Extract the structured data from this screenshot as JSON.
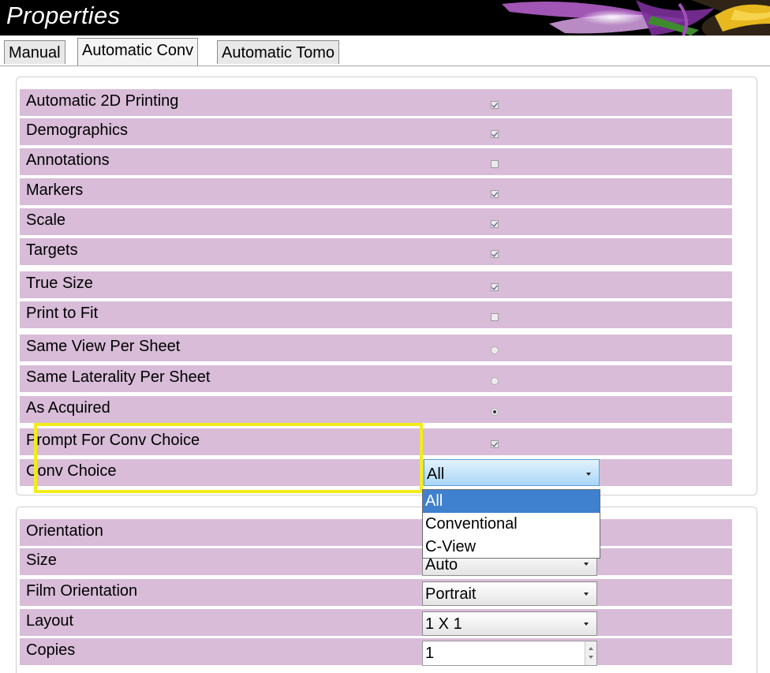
{
  "window": {
    "title": "Properties"
  },
  "tabs": [
    {
      "label": "Manual"
    },
    {
      "label": "Automatic Conv"
    },
    {
      "label": "Automatic Tomo"
    }
  ],
  "print_options": [
    {
      "label": "Automatic 2D Printing",
      "control": "checkbox",
      "checked": true
    },
    {
      "label": "Demographics",
      "control": "checkbox",
      "checked": true
    },
    {
      "label": "Annotations",
      "control": "checkbox",
      "checked": false
    },
    {
      "label": "Markers",
      "control": "checkbox",
      "checked": true
    },
    {
      "label": "Scale",
      "control": "checkbox",
      "checked": true
    },
    {
      "label": "Targets",
      "control": "checkbox",
      "checked": true
    },
    {
      "label": "True Size",
      "control": "checkbox",
      "checked": true
    },
    {
      "label": "Print to Fit",
      "control": "checkbox",
      "checked": false
    },
    {
      "label": "Same View Per Sheet",
      "control": "radio",
      "checked": false
    },
    {
      "label": "Same Laterality Per Sheet",
      "control": "radio",
      "checked": false
    },
    {
      "label": "As Acquired",
      "control": "radio",
      "checked": true
    },
    {
      "label": "Prompt For Conv Choice",
      "control": "checkbox",
      "checked": true
    },
    {
      "label": "Conv Choice",
      "control": "dropdown",
      "value": "All"
    }
  ],
  "conv_choice_dropdown": {
    "options": [
      "All",
      "Conventional",
      "C-View"
    ],
    "selected": "All"
  },
  "film_options": [
    {
      "label": "Orientation",
      "control": "dropdown",
      "value": ""
    },
    {
      "label": "Size",
      "control": "dropdown",
      "value": "Auto"
    },
    {
      "label": "Film Orientation",
      "control": "dropdown",
      "value": "Portrait"
    },
    {
      "label": "Layout",
      "control": "dropdown",
      "value": "1 X 1"
    },
    {
      "label": "Copies",
      "control": "spinbox",
      "value": "1"
    }
  ],
  "colors": {
    "row_background": "#d8bcd8",
    "highlight_border": "#f2ec1c",
    "selected_option": "#3f80cf",
    "title_bar": "#000000"
  }
}
